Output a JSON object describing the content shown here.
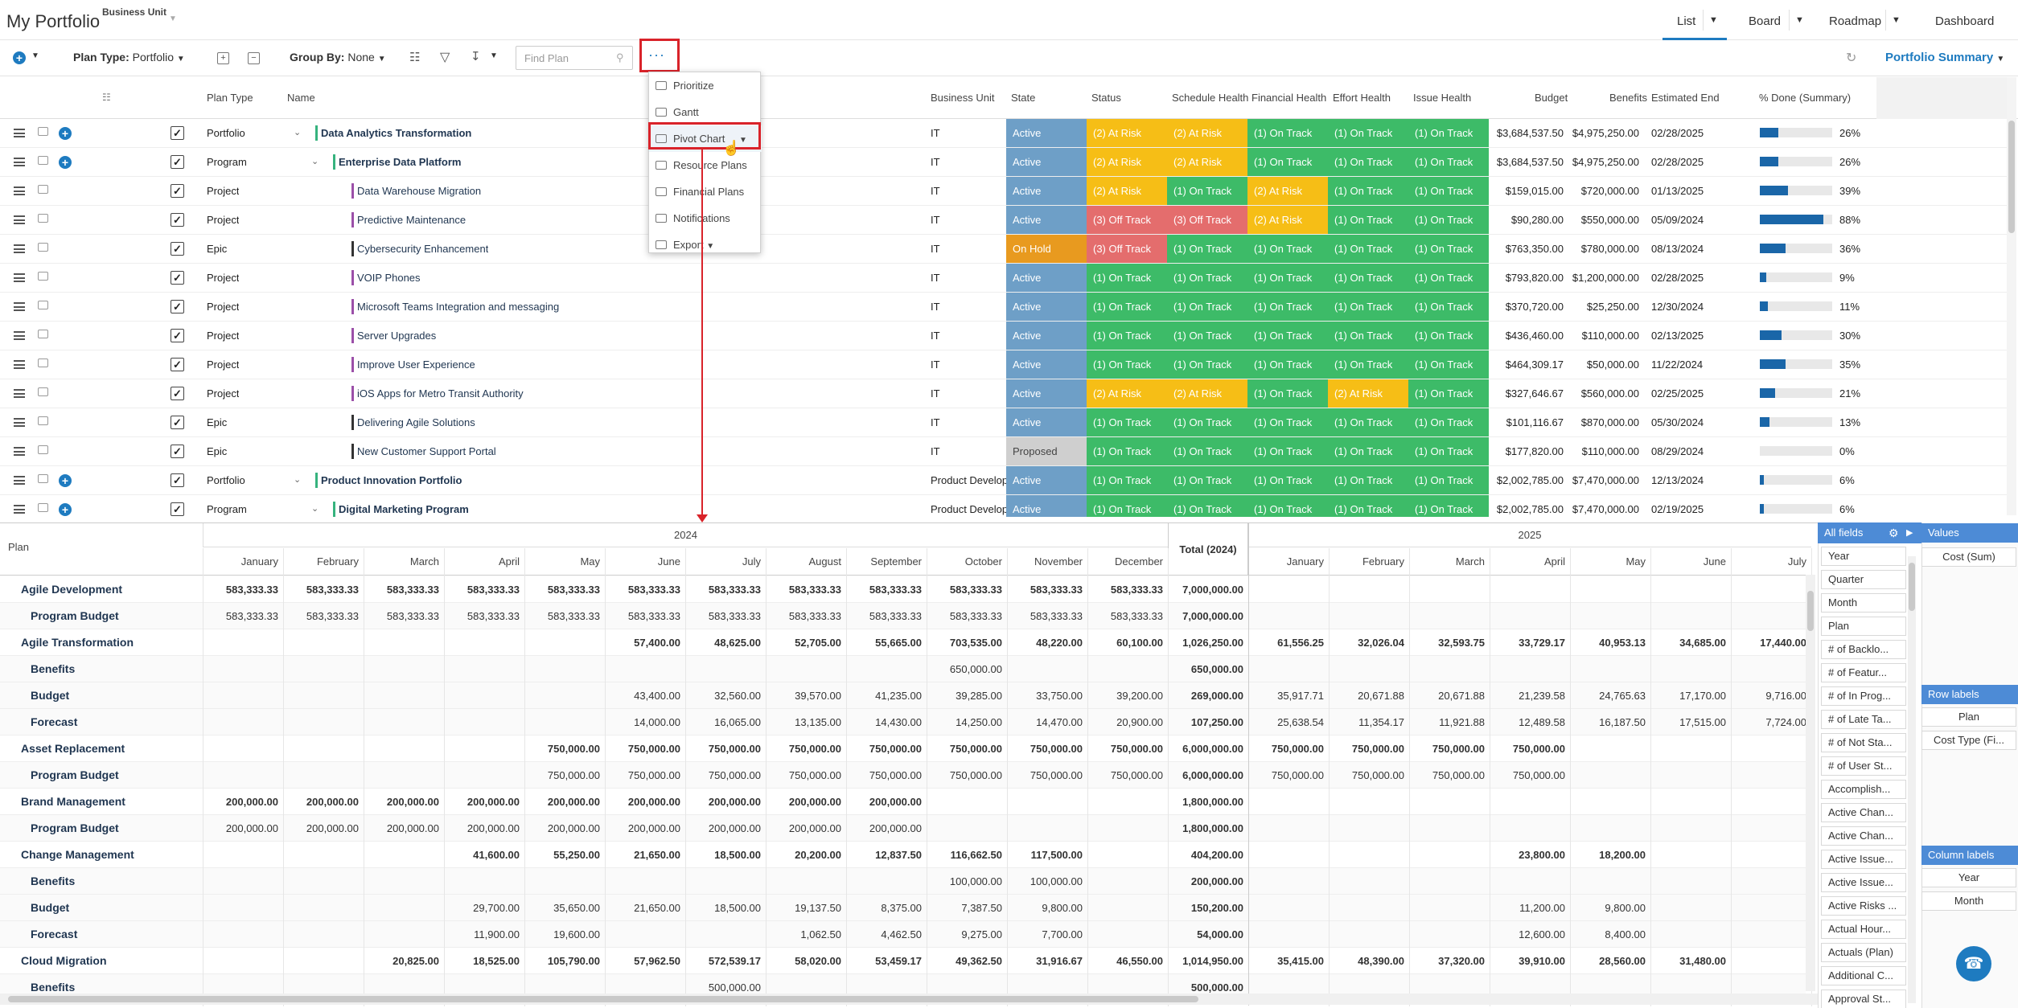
{
  "app": {
    "title": "My Portfolio",
    "business_unit_label": "Business Unit"
  },
  "views": {
    "list": "List",
    "board": "Board",
    "roadmap": "Roadmap",
    "dashboard": "Dashboard"
  },
  "toolbar": {
    "plan_type_label": "Plan Type:",
    "plan_type_value": "Portfolio",
    "group_by_label": "Group By:",
    "group_by_value": "None",
    "find_placeholder": "Find Plan",
    "more_label": "···",
    "portfolio_summary": "Portfolio Summary"
  },
  "grid": {
    "columns": {
      "plan_type": "Plan Type",
      "name": "Name",
      "business_unit": "Business Unit",
      "state": "State",
      "status": "Status",
      "schedule_health": "Schedule Health",
      "financial_health": "Financial Health",
      "effort_health": "Effort Health",
      "issue_health": "Issue Health",
      "budget": "Budget",
      "benefits": "Benefits",
      "estimated_end": "Estimated End",
      "pct_done": "% Done (Summary)"
    },
    "rows": [
      {
        "type": "Portfolio",
        "name": "Data Analytics Transformation",
        "bu": "IT",
        "state": "Active",
        "status": "(2) At Risk",
        "schedule": "(2) At Risk",
        "financial": "(1) On Track",
        "effort": "(1) On Track",
        "issue": "(1) On Track",
        "budget": "$3,684,537.50",
        "benefits": "$4,975,250.00",
        "end": "02/28/2025",
        "pct": 26,
        "pct_label": "26%"
      },
      {
        "type": "Program",
        "name": "Enterprise Data Platform",
        "bu": "IT",
        "state": "Active",
        "status": "(2) At Risk",
        "schedule": "(2) At Risk",
        "financial": "(1) On Track",
        "effort": "(1) On Track",
        "issue": "(1) On Track",
        "budget": "$3,684,537.50",
        "benefits": "$4,975,250.00",
        "end": "02/28/2025",
        "pct": 26,
        "pct_label": "26%"
      },
      {
        "type": "Project",
        "name": "Data Warehouse Migration",
        "bu": "IT",
        "state": "Active",
        "status": "(2) At Risk",
        "schedule": "(1) On Track",
        "financial": "(2) At Risk",
        "effort": "(1) On Track",
        "issue": "(1) On Track",
        "budget": "$159,015.00",
        "benefits": "$720,000.00",
        "end": "01/13/2025",
        "pct": 39,
        "pct_label": "39%"
      },
      {
        "type": "Project",
        "name": "Predictive Maintenance",
        "bu": "IT",
        "state": "Active",
        "status": "(3) Off Track",
        "schedule": "(3) Off Track",
        "financial": "(2) At Risk",
        "effort": "(1) On Track",
        "issue": "(1) On Track",
        "budget": "$90,280.00",
        "benefits": "$550,000.00",
        "end": "05/09/2024",
        "pct": 88,
        "pct_label": "88%"
      },
      {
        "type": "Epic",
        "name": "Cybersecurity Enhancement",
        "bu": "IT",
        "state": "On Hold",
        "status": "(3) Off Track",
        "schedule": "(1) On Track",
        "financial": "(1) On Track",
        "effort": "(1) On Track",
        "issue": "(1) On Track",
        "budget": "$763,350.00",
        "benefits": "$780,000.00",
        "end": "08/13/2024",
        "pct": 36,
        "pct_label": "36%"
      },
      {
        "type": "Project",
        "name": "VOIP Phones",
        "bu": "IT",
        "state": "Active",
        "status": "(1) On Track",
        "schedule": "(1) On Track",
        "financial": "(1) On Track",
        "effort": "(1) On Track",
        "issue": "(1) On Track",
        "budget": "$793,820.00",
        "benefits": "$1,200,000.00",
        "end": "02/28/2025",
        "pct": 9,
        "pct_label": "9%"
      },
      {
        "type": "Project",
        "name": "Microsoft Teams Integration and messaging",
        "bu": "IT",
        "state": "Active",
        "status": "(1) On Track",
        "schedule": "(1) On Track",
        "financial": "(1) On Track",
        "effort": "(1) On Track",
        "issue": "(1) On Track",
        "budget": "$370,720.00",
        "benefits": "$25,250.00",
        "end": "12/30/2024",
        "pct": 11,
        "pct_label": "11%"
      },
      {
        "type": "Project",
        "name": "Server Upgrades",
        "bu": "IT",
        "state": "Active",
        "status": "(1) On Track",
        "schedule": "(1) On Track",
        "financial": "(1) On Track",
        "effort": "(1) On Track",
        "issue": "(1) On Track",
        "budget": "$436,460.00",
        "benefits": "$110,000.00",
        "end": "02/13/2025",
        "pct": 30,
        "pct_label": "30%"
      },
      {
        "type": "Project",
        "name": "Improve User Experience",
        "bu": "IT",
        "state": "Active",
        "status": "(1) On Track",
        "schedule": "(1) On Track",
        "financial": "(1) On Track",
        "effort": "(1) On Track",
        "issue": "(1) On Track",
        "budget": "$464,309.17",
        "benefits": "$50,000.00",
        "end": "11/22/2024",
        "pct": 35,
        "pct_label": "35%"
      },
      {
        "type": "Project",
        "name": "iOS Apps for Metro Transit Authority",
        "bu": "IT",
        "state": "Active",
        "status": "(2) At Risk",
        "schedule": "(2) At Risk",
        "financial": "(1) On Track",
        "effort": "(2) At Risk",
        "issue": "(1) On Track",
        "budget": "$327,646.67",
        "benefits": "$560,000.00",
        "end": "02/25/2025",
        "pct": 21,
        "pct_label": "21%"
      },
      {
        "type": "Epic",
        "name": "Delivering Agile Solutions",
        "bu": "IT",
        "state": "Active",
        "status": "(1) On Track",
        "schedule": "(1) On Track",
        "financial": "(1) On Track",
        "effort": "(1) On Track",
        "issue": "(1) On Track",
        "budget": "$101,116.67",
        "benefits": "$870,000.00",
        "end": "05/30/2024",
        "pct": 13,
        "pct_label": "13%"
      },
      {
        "type": "Epic",
        "name": "New Customer Support Portal",
        "bu": "IT",
        "state": "Proposed",
        "status": "(1) On Track",
        "schedule": "(1) On Track",
        "financial": "(1) On Track",
        "effort": "(1) On Track",
        "issue": "(1) On Track",
        "budget": "$177,820.00",
        "benefits": "$110,000.00",
        "end": "08/29/2024",
        "pct": 0,
        "pct_label": "0%"
      },
      {
        "type": "Portfolio",
        "name": "Product Innovation Portfolio",
        "bu": "Product Develop",
        "state": "Active",
        "status": "(1) On Track",
        "schedule": "(1) On Track",
        "financial": "(1) On Track",
        "effort": "(1) On Track",
        "issue": "(1) On Track",
        "budget": "$2,002,785.00",
        "benefits": "$7,470,000.00",
        "end": "12/13/2024",
        "pct": 6,
        "pct_label": "6%"
      },
      {
        "type": "Program",
        "name": "Digital Marketing Program",
        "bu": "Product Develop",
        "state": "Active",
        "status": "(1) On Track",
        "schedule": "(1) On Track",
        "financial": "(1) On Track",
        "effort": "(1) On Track",
        "issue": "(1) On Track",
        "budget": "$2,002,785.00",
        "benefits": "$7,470,000.00",
        "end": "02/19/2025",
        "pct": 6,
        "pct_label": "6%"
      }
    ]
  },
  "more_menu": [
    "Prioritize",
    "Gantt",
    "Pivot Chart",
    "Resource Plans",
    "Financial Plans",
    "Notifications",
    "Export"
  ],
  "pivot": {
    "row_header": "Plan",
    "year_2024": "2024",
    "year_2025": "2025",
    "total_label": "Total (2024)",
    "months_2024": [
      "January",
      "February",
      "March",
      "April",
      "May",
      "June",
      "July",
      "August",
      "September",
      "October",
      "November",
      "December"
    ],
    "months_2025": [
      "January",
      "February",
      "March",
      "April",
      "May",
      "June",
      "July"
    ],
    "rows": [
      {
        "label": "Agile Development",
        "level": 0,
        "v": [
          "583,333.33",
          "583,333.33",
          "583,333.33",
          "583,333.33",
          "583,333.33",
          "583,333.33",
          "583,333.33",
          "583,333.33",
          "583,333.33",
          "583,333.33",
          "583,333.33",
          "583,333.33"
        ],
        "total": "7,000,000.00",
        "v25": [
          "",
          "",
          "",
          "",
          "",
          "",
          ""
        ]
      },
      {
        "label": "Program Budget",
        "level": 1,
        "v": [
          "583,333.33",
          "583,333.33",
          "583,333.33",
          "583,333.33",
          "583,333.33",
          "583,333.33",
          "583,333.33",
          "583,333.33",
          "583,333.33",
          "583,333.33",
          "583,333.33",
          "583,333.33"
        ],
        "total": "7,000,000.00",
        "v25": [
          "",
          "",
          "",
          "",
          "",
          "",
          ""
        ]
      },
      {
        "label": "Agile Transformation",
        "level": 0,
        "v": [
          "",
          "",
          "",
          "",
          "",
          "57,400.00",
          "48,625.00",
          "52,705.00",
          "55,665.00",
          "703,535.00",
          "48,220.00",
          "60,100.00"
        ],
        "total": "1,026,250.00",
        "v25": [
          "61,556.25",
          "32,026.04",
          "32,593.75",
          "33,729.17",
          "40,953.13",
          "34,685.00",
          "17,440.00"
        ]
      },
      {
        "label": "Benefits",
        "level": 1,
        "v": [
          "",
          "",
          "",
          "",
          "",
          "",
          "",
          "",
          "",
          "650,000.00",
          "",
          ""
        ],
        "total": "650,000.00",
        "v25": [
          "",
          "",
          "",
          "",
          "",
          "",
          ""
        ]
      },
      {
        "label": "Budget",
        "level": 1,
        "v": [
          "",
          "",
          "",
          "",
          "",
          "43,400.00",
          "32,560.00",
          "39,570.00",
          "41,235.00",
          "39,285.00",
          "33,750.00",
          "39,200.00"
        ],
        "total": "269,000.00",
        "v25": [
          "35,917.71",
          "20,671.88",
          "20,671.88",
          "21,239.58",
          "24,765.63",
          "17,170.00",
          "9,716.00"
        ]
      },
      {
        "label": "Forecast",
        "level": 1,
        "v": [
          "",
          "",
          "",
          "",
          "",
          "14,000.00",
          "16,065.00",
          "13,135.00",
          "14,430.00",
          "14,250.00",
          "14,470.00",
          "20,900.00"
        ],
        "total": "107,250.00",
        "v25": [
          "25,638.54",
          "11,354.17",
          "11,921.88",
          "12,489.58",
          "16,187.50",
          "17,515.00",
          "7,724.00"
        ]
      },
      {
        "label": "Asset Replacement",
        "level": 0,
        "v": [
          "",
          "",
          "",
          "",
          "750,000.00",
          "750,000.00",
          "750,000.00",
          "750,000.00",
          "750,000.00",
          "750,000.00",
          "750,000.00",
          "750,000.00"
        ],
        "total": "6,000,000.00",
        "v25": [
          "750,000.00",
          "750,000.00",
          "750,000.00",
          "750,000.00",
          "",
          "",
          ""
        ]
      },
      {
        "label": "Program Budget",
        "level": 1,
        "v": [
          "",
          "",
          "",
          "",
          "750,000.00",
          "750,000.00",
          "750,000.00",
          "750,000.00",
          "750,000.00",
          "750,000.00",
          "750,000.00",
          "750,000.00"
        ],
        "total": "6,000,000.00",
        "v25": [
          "750,000.00",
          "750,000.00",
          "750,000.00",
          "750,000.00",
          "",
          "",
          ""
        ]
      },
      {
        "label": "Brand Management",
        "level": 0,
        "v": [
          "200,000.00",
          "200,000.00",
          "200,000.00",
          "200,000.00",
          "200,000.00",
          "200,000.00",
          "200,000.00",
          "200,000.00",
          "200,000.00",
          "",
          "",
          ""
        ],
        "total": "1,800,000.00",
        "v25": [
          "",
          "",
          "",
          "",
          "",
          "",
          ""
        ]
      },
      {
        "label": "Program Budget",
        "level": 1,
        "v": [
          "200,000.00",
          "200,000.00",
          "200,000.00",
          "200,000.00",
          "200,000.00",
          "200,000.00",
          "200,000.00",
          "200,000.00",
          "200,000.00",
          "",
          "",
          ""
        ],
        "total": "1,800,000.00",
        "v25": [
          "",
          "",
          "",
          "",
          "",
          "",
          ""
        ]
      },
      {
        "label": "Change Management",
        "level": 0,
        "v": [
          "",
          "",
          "",
          "41,600.00",
          "55,250.00",
          "21,650.00",
          "18,500.00",
          "20,200.00",
          "12,837.50",
          "116,662.50",
          "117,500.00",
          ""
        ],
        "total": "404,200.00",
        "v25": [
          "",
          "",
          "",
          "23,800.00",
          "18,200.00",
          "",
          ""
        ]
      },
      {
        "label": "Benefits",
        "level": 1,
        "v": [
          "",
          "",
          "",
          "",
          "",
          "",
          "",
          "",
          "",
          "100,000.00",
          "100,000.00",
          ""
        ],
        "total": "200,000.00",
        "v25": [
          "",
          "",
          "",
          "",
          "",
          "",
          ""
        ]
      },
      {
        "label": "Budget",
        "level": 1,
        "v": [
          "",
          "",
          "",
          "29,700.00",
          "35,650.00",
          "21,650.00",
          "18,500.00",
          "19,137.50",
          "8,375.00",
          "7,387.50",
          "9,800.00",
          ""
        ],
        "total": "150,200.00",
        "v25": [
          "",
          "",
          "",
          "11,200.00",
          "9,800.00",
          "",
          ""
        ]
      },
      {
        "label": "Forecast",
        "level": 1,
        "v": [
          "",
          "",
          "",
          "11,900.00",
          "19,600.00",
          "",
          "",
          "1,062.50",
          "4,462.50",
          "9,275.00",
          "7,700.00",
          ""
        ],
        "total": "54,000.00",
        "v25": [
          "",
          "",
          "",
          "12,600.00",
          "8,400.00",
          "",
          ""
        ]
      },
      {
        "label": "Cloud Migration",
        "level": 0,
        "v": [
          "",
          "",
          "20,825.00",
          "18,525.00",
          "105,790.00",
          "57,962.50",
          "572,539.17",
          "58,020.00",
          "53,459.17",
          "49,362.50",
          "31,916.67",
          "46,550.00"
        ],
        "total": "1,014,950.00",
        "v25": [
          "35,415.00",
          "48,390.00",
          "37,320.00",
          "39,910.00",
          "28,560.00",
          "31,480.00",
          ""
        ]
      },
      {
        "label": "Benefits",
        "level": 1,
        "v": [
          "",
          "",
          "",
          "",
          "",
          "",
          "500,000.00",
          "",
          "",
          "",
          "",
          ""
        ],
        "total": "500,000.00",
        "v25": [
          "",
          "",
          "",
          "",
          "",
          "",
          ""
        ]
      }
    ]
  },
  "fields_panel": {
    "header": "All fields",
    "items": [
      "Year",
      "Quarter",
      "Month",
      "Plan",
      "# of Backlo...",
      "# of Featur...",
      "# of In Prog...",
      "# of Late Ta...",
      "# of Not Sta...",
      "# of User St...",
      "Accomplish...",
      "Active Chan...",
      "Active Chan...",
      "Active Issue...",
      "Active Issue...",
      "Active Risks ...",
      "Actual Hour...",
      "Actuals (Plan)",
      "Additional C...",
      "Approval St..."
    ],
    "values_label": "Values",
    "values": [
      "Cost (Sum)"
    ],
    "row_labels_label": "Row labels",
    "row_labels": [
      "Plan",
      "Cost Type (Fi..."
    ],
    "column_labels_label": "Column labels",
    "column_labels": [
      "Year",
      "Month"
    ]
  },
  "colors": {
    "active": "#6e9fc7",
    "on_hold": "#e89a1f",
    "proposed": "#cfcfcf",
    "on_track": "#3dbb68",
    "at_risk": "#f6be16",
    "off_track": "#e46d6d",
    "accent": "#1e7bc0"
  }
}
